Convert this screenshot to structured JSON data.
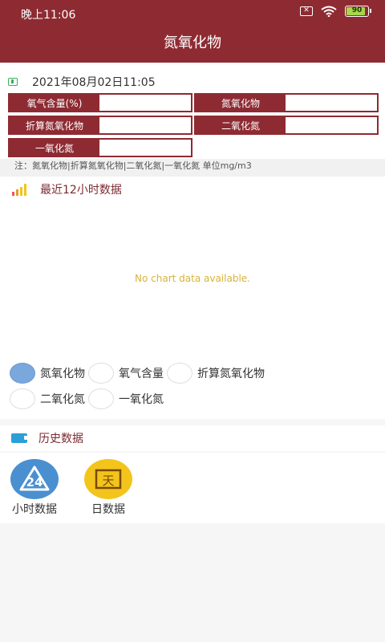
{
  "status": {
    "time": "晚上11:06",
    "battery": "90",
    "sim_glyph": "✕"
  },
  "header": {
    "title": "氮氧化物"
  },
  "datetime": "2021年08月02日11:05",
  "metrics": [
    {
      "label": "氧气含量(%)",
      "value": ""
    },
    {
      "label": "氮氧化物",
      "value": ""
    },
    {
      "label": "折算氮氧化物",
      "value": ""
    },
    {
      "label": "二氧化氮",
      "value": ""
    },
    {
      "label": "一氧化氮",
      "value": ""
    }
  ],
  "note": "注：氮氧化物|折算氮氧化物|二氧化氮|一氧化氮 单位mg/m3",
  "chart_section": {
    "title": "最近12小时数据",
    "empty_text": "No chart data available."
  },
  "series_options": [
    {
      "label": "氮氧化物",
      "selected": true
    },
    {
      "label": "氧气含量",
      "selected": false
    },
    {
      "label": "折算氮氧化物",
      "selected": false
    },
    {
      "label": "二氧化氮",
      "selected": false
    },
    {
      "label": "一氧化氮",
      "selected": false
    }
  ],
  "history_section": {
    "title": "历史数据",
    "items": [
      {
        "label": "小时数据",
        "glyph": "24",
        "icon": "hour-24-icon",
        "color": "#4a8fd0"
      },
      {
        "label": "日数据",
        "glyph": "天",
        "icon": "calendar-day-icon",
        "color": "#f3c41b"
      }
    ]
  },
  "colors": {
    "brand": "#8e2b32",
    "accent_blue": "#7aa8dc",
    "no_data": "#d8b23a"
  }
}
